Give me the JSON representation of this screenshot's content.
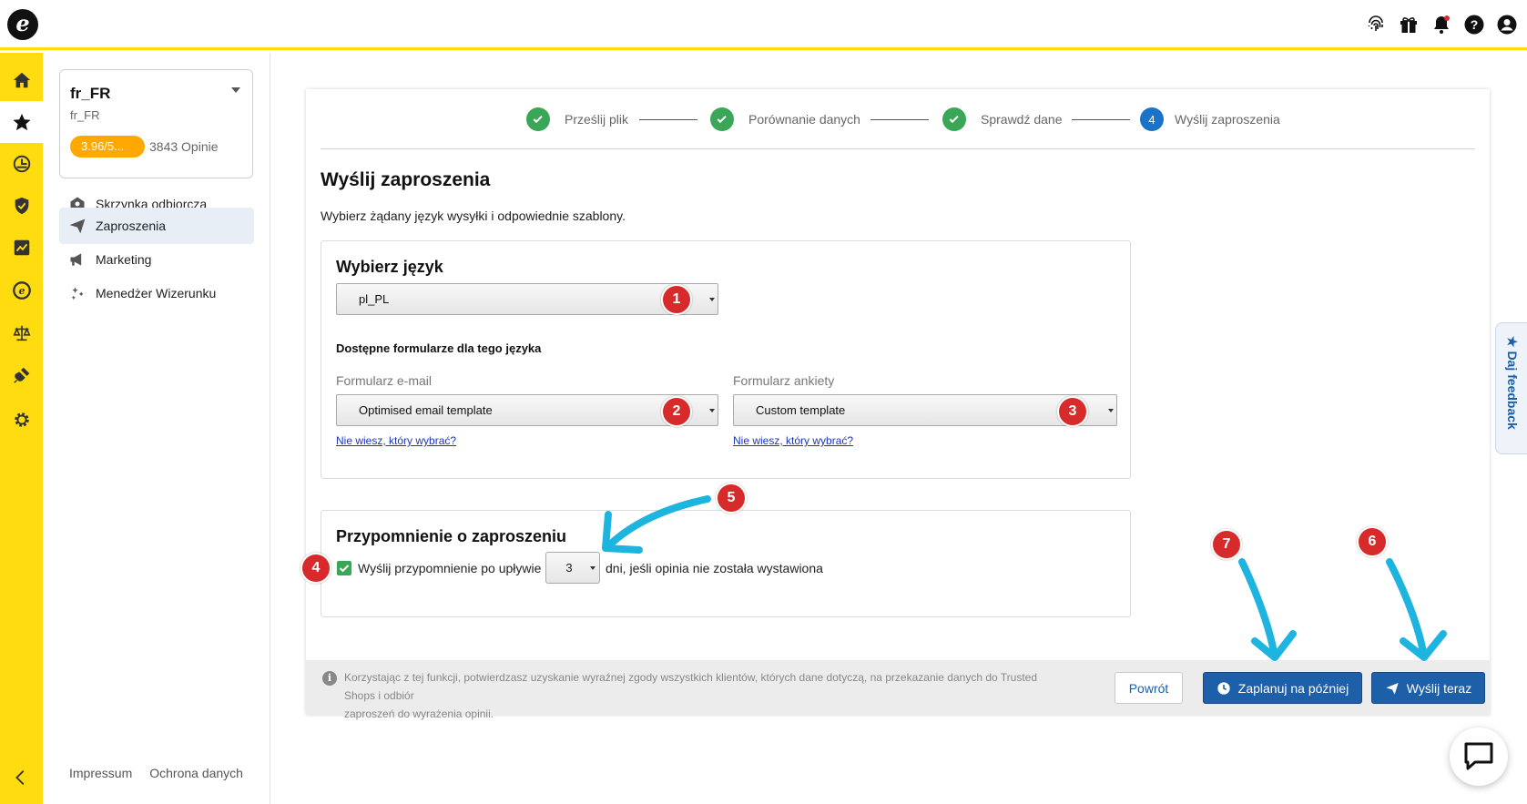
{
  "app": {
    "logo_letter": "e"
  },
  "top_icons": [
    "fingerprint-icon",
    "gift-icon",
    "bell-icon",
    "help-icon",
    "account-icon"
  ],
  "rail": [
    "home-icon",
    "star-icon",
    "dashboard-icon",
    "shield-icon",
    "chart-icon",
    "etrusted-icon",
    "scales-icon",
    "plug-icon",
    "gear-icon"
  ],
  "shop": {
    "name": "fr_FR",
    "locale": "fr_FR",
    "rating": "3.96/5...",
    "reviews": "3843 Opinie"
  },
  "nav": {
    "inbox": "Skrzynka odbiorcza",
    "invites": "Zaproszenia",
    "marketing": "Marketing",
    "image_manager": "Menedżer Wizerunku"
  },
  "footer_links": {
    "impressum": "Impressum",
    "privacy": "Ochrona danych"
  },
  "stepper": {
    "step1": "Prześlij plik",
    "step2": "Porównanie danych",
    "step3": "Sprawdź dane",
    "step4_number": "4",
    "step4": "Wyślij zaproszenia"
  },
  "page": {
    "title": "Wyślij zaproszenia",
    "subtitle": "Wybierz żądany język wysyłki i odpowiednie szablony."
  },
  "language": {
    "title": "Wybierz język",
    "selected": "pl_PL",
    "forms_label": "Dostępne formularze dla tego języka",
    "email_label": "Formularz e-mail",
    "email_value": "Optimised email template",
    "survey_label": "Formularz ankiety",
    "survey_value": "Custom template",
    "help_link": "Nie wiesz, który wybrać?"
  },
  "reminder": {
    "title": "Przypomnienie o zaproszeniu",
    "before": "Wyślij przypomnienie po upływie",
    "days": "3",
    "after": "dni, jeśli opinia nie została wystawiona"
  },
  "footer": {
    "consent_line1": "Korzystając z tej funkcji, potwierdzasz uzyskanie wyraźnej zgody wszystkich klientów, których dane dotyczą, na przekazanie danych do Trusted Shops i odbiór",
    "consent_line2": "zaproszeń do wyrażenia opinii.",
    "back": "Powrót",
    "schedule": "Zaplanuj na później",
    "send_now": "Wyślij teraz"
  },
  "feedback": {
    "label": "★ Daj feedback"
  },
  "badges": [
    "1",
    "2",
    "3",
    "4",
    "5",
    "6",
    "7"
  ],
  "colors": {
    "brand_yellow": "#ffdc0f",
    "primary_blue": "#1d5fa8",
    "success_green": "#3aa657",
    "badge_red": "#d72b2b",
    "arrow_cyan": "#1eb4e0"
  }
}
